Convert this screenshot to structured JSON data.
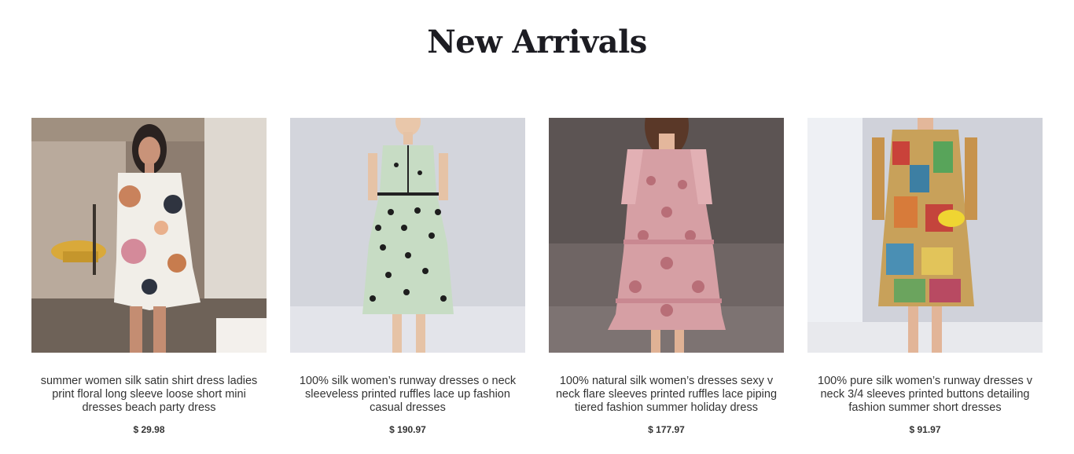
{
  "section": {
    "title": "New Arrivals"
  },
  "products": [
    {
      "name": "summer women silk satin shirt dress ladies print floral long sleeve loose short mini dresses beach party dress",
      "price": "$ 29.98",
      "image_alt": "woman in white floral print satin shirt dress"
    },
    {
      "name": "100% silk women’s runway dresses o neck sleeveless printed ruffles lace up fashion casual dresses",
      "price": "$ 190.97",
      "image_alt": "model in mint green polka dot sleeveless midi dress"
    },
    {
      "name": "100% natural silk women’s dresses sexy v neck flare sleeves printed ruffles lace piping tiered fashion summer holiday dress",
      "price": "$ 177.97",
      "image_alt": "model in pink paisley print tiered ruffle dress"
    },
    {
      "name": "100% pure silk women’s runway dresses v neck 3/4 sleeves printed buttons detailing fashion summer short dresses",
      "price": "$ 91.97",
      "image_alt": "model in multicolor patchwork print short dress with yellow clutch"
    }
  ]
}
